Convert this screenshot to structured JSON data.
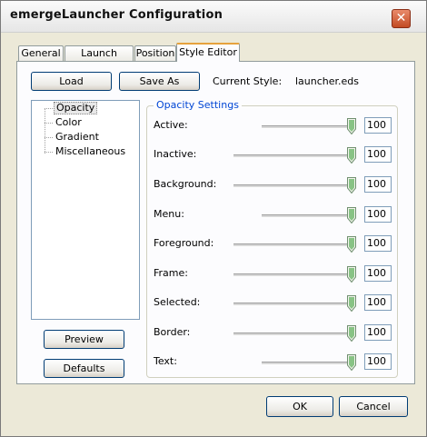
{
  "window": {
    "title": "emergeLauncher Configuration",
    "close_symbol": "✕"
  },
  "tabs": [
    {
      "label": "General",
      "active": false
    },
    {
      "label": "Launch Items",
      "active": false
    },
    {
      "label": "Position",
      "active": false
    },
    {
      "label": "Style Editor",
      "active": true
    }
  ],
  "toolbar": {
    "load_label": "Load",
    "save_as_label": "Save As",
    "current_style_label": "Current Style:",
    "current_style_value": "launcher.eds"
  },
  "tree": {
    "items": [
      {
        "label": "Opacity",
        "selected": true
      },
      {
        "label": "Color",
        "selected": false
      },
      {
        "label": "Gradient",
        "selected": false
      },
      {
        "label": "Miscellaneous",
        "selected": false
      }
    ]
  },
  "opacity_settings": {
    "title": "Opacity Settings",
    "rows": [
      {
        "label": "Active:",
        "value": "100"
      },
      {
        "label": "Inactive:",
        "value": "100"
      },
      {
        "label": "Background:",
        "value": "100"
      },
      {
        "label": "Menu:",
        "value": "100"
      },
      {
        "label": "Foreground:",
        "value": "100"
      },
      {
        "label": "Frame:",
        "value": "100"
      },
      {
        "label": "Selected:",
        "value": "100"
      },
      {
        "label": "Border:",
        "value": "100"
      },
      {
        "label": "Text:",
        "value": "100"
      }
    ]
  },
  "side_buttons": {
    "preview_label": "Preview",
    "defaults_label": "Defaults"
  },
  "dialog_buttons": {
    "ok_label": "OK",
    "cancel_label": "Cancel"
  },
  "colors": {
    "accent_tab": "#e6a23d",
    "group_title": "#0046d5",
    "thumb": "#2f9b2f"
  }
}
